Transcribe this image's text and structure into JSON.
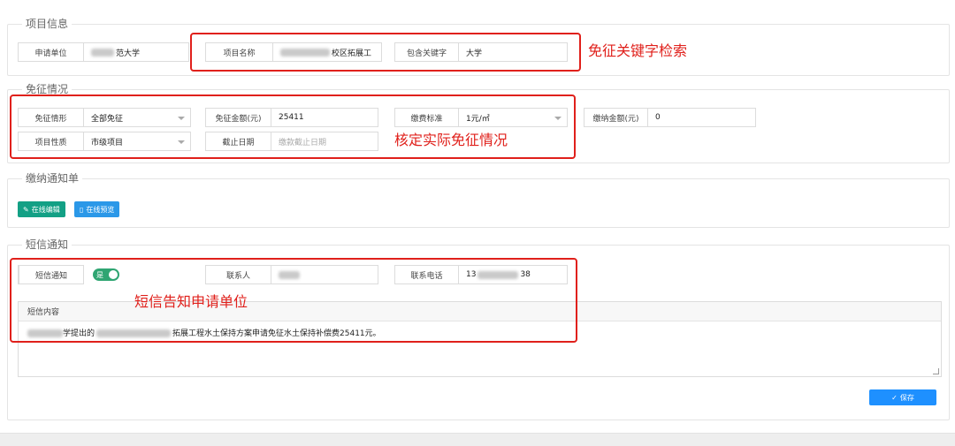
{
  "project_info": {
    "legend": "项目信息",
    "applicant_label": "申请单位",
    "applicant_value": "范大学",
    "project_name_label": "项目名称",
    "project_name_value": "校区拓展工",
    "keyword_label": "包含关键字",
    "keyword_value": "大学"
  },
  "exemption": {
    "legend": "免征情况",
    "type_label": "免征情形",
    "type_value": "全部免征",
    "amount_label": "免征金额(元)",
    "amount_value": "25411",
    "fee_standard_label": "缴费标准",
    "fee_standard_value": "1元/㎡",
    "paid_amount_label": "缴纳金额(元)",
    "paid_amount_value": "0",
    "nature_label": "项目性质",
    "nature_value": "市级项目",
    "deadline_label": "截止日期",
    "deadline_placeholder": "缴款截止日期"
  },
  "notice": {
    "legend": "缴纳通知单",
    "edit_button": "在线编辑",
    "preview_button": "在线预览"
  },
  "sms": {
    "legend": "短信通知",
    "sms_label": "短信通知",
    "toggle_text": "是",
    "toggle_on": true,
    "contact_label": "联系人",
    "phone_label": "联系电话",
    "phone_prefix": "13",
    "phone_suffix": "38",
    "content_label": "短信内容",
    "content_mid": "学提出的",
    "content_tail": "拓展工程水土保持方案申请免征水土保持补偿费25411元。",
    "save_button": "保存"
  },
  "annotations": {
    "keyword_search": "免征关键字检索",
    "verify_exemption": "核定实际免征情况",
    "sms_notify": "短信告知申请单位"
  },
  "colors": {
    "annotation_red": "#e0201b",
    "edit_button_green": "#13a085",
    "preview_button_blue": "#2b98e8",
    "save_button_blue": "#1e90ff",
    "toggle_green": "#2fa572"
  }
}
